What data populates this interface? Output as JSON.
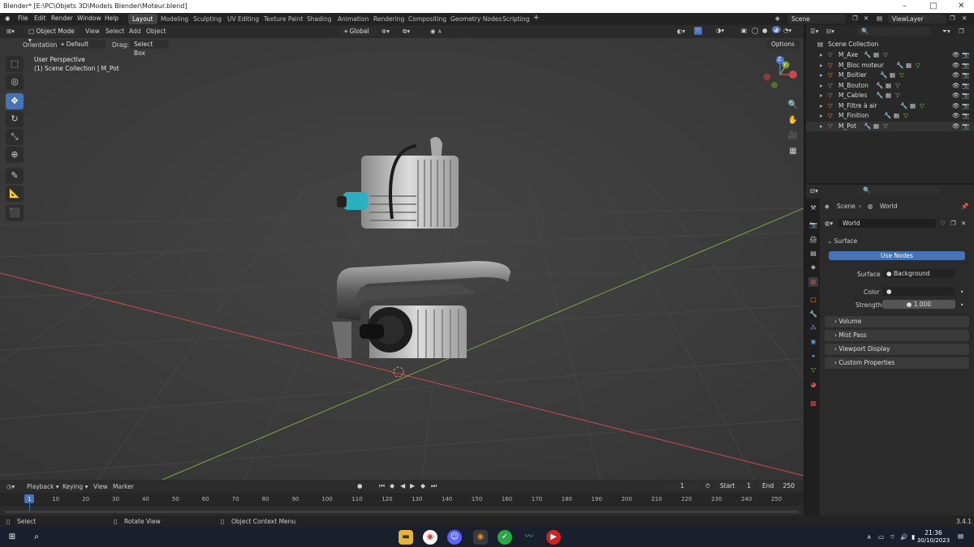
{
  "window": {
    "title": "Blender* [E:\\PC\\Objets 3D\\Models Blender\\Moteur.blend]"
  },
  "menu": [
    "File",
    "Edit",
    "Render",
    "Window",
    "Help"
  ],
  "workspaces": [
    "Layout",
    "Modeling",
    "Sculpting",
    "UV Editing",
    "Texture Paint",
    "Shading",
    "Animation",
    "Rendering",
    "Compositing",
    "Geometry Nodes",
    "Scripting"
  ],
  "active_workspace": "Layout",
  "scene_field": "Scene",
  "viewlayer_field": "ViewLayer",
  "viewport": {
    "mode": "Object Mode",
    "menus": [
      "View",
      "Select",
      "Add",
      "Object"
    ],
    "transform_orientation": "Global",
    "orientation_label": "Orientation:",
    "orientation_value": "Default",
    "drag_label": "Drag:",
    "drag_value": "Select Box",
    "options": "Options",
    "view_name": "User Perspective",
    "collection_info": "(1) Scene Collection | M_Pot",
    "gizmo_z": "Z",
    "gizmo_y": "Y"
  },
  "outliner": {
    "root": "Scene Collection",
    "items": [
      "M_Axe",
      "M_Bloc moteur",
      "M_Boitier",
      "M_Bouton",
      "M_Cables",
      "M_Filtre à air",
      "M_Finition",
      "M_Pot"
    ]
  },
  "properties": {
    "breadcrumb_scene": "Scene",
    "breadcrumb_world": "World",
    "world_name": "World",
    "surface_header": "Surface",
    "use_nodes": "Use Nodes",
    "surface_label": "Surface",
    "surface_value": "Background",
    "color_label": "Color",
    "strength_label": "Strength",
    "strength_value": "1.000",
    "panels": [
      "Volume",
      "Mist Pass",
      "Viewport Display",
      "Custom Properties"
    ]
  },
  "timeline": {
    "menus": [
      "Playback",
      "Keying",
      "View",
      "Marker"
    ],
    "current_frame": "1",
    "start_label": "Start",
    "start_value": "1",
    "end_label": "End",
    "end_value": "250",
    "ticks": [
      "1",
      "10",
      "20",
      "30",
      "40",
      "50",
      "60",
      "70",
      "80",
      "90",
      "100",
      "110",
      "120",
      "130",
      "140",
      "150",
      "160",
      "170",
      "180",
      "190",
      "200",
      "210",
      "220",
      "230",
      "240",
      "250"
    ]
  },
  "statusbar": {
    "select": "Select",
    "rotate": "Rotate View",
    "context": "Object Context Menu",
    "version": "3.4.1"
  },
  "taskbar": {
    "time": "21:36",
    "date": "30/10/2023"
  },
  "colors": {
    "accent": "#4772b3",
    "x_axis": "#c94a4a",
    "y_axis": "#7fa33a",
    "orange": "#e8892e"
  }
}
